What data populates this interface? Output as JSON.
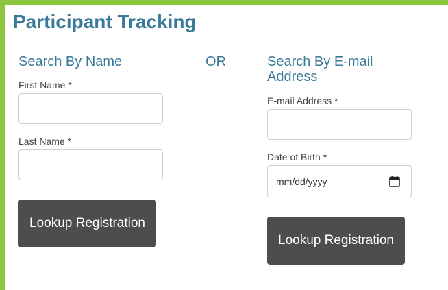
{
  "page": {
    "title": "Participant Tracking"
  },
  "name_search": {
    "heading": "Search By Name",
    "first_name_label": "First Name *",
    "first_name_value": "",
    "last_name_label": "Last Name *",
    "last_name_value": "",
    "button_label": "Lookup Registration"
  },
  "separator": "OR",
  "email_search": {
    "heading": "Search By E-mail Address",
    "email_label": "E-mail Address *",
    "email_value": "",
    "dob_label": "Date of Birth *",
    "dob_placeholder": "mm/dd/yyyy",
    "button_label": "Lookup Registration"
  },
  "colors": {
    "accent": "#3a7a98",
    "background": "#8cc63f",
    "splash": "#d4e021",
    "button": "#4d4d4d"
  },
  "icons": {
    "date": "calendar-icon"
  }
}
